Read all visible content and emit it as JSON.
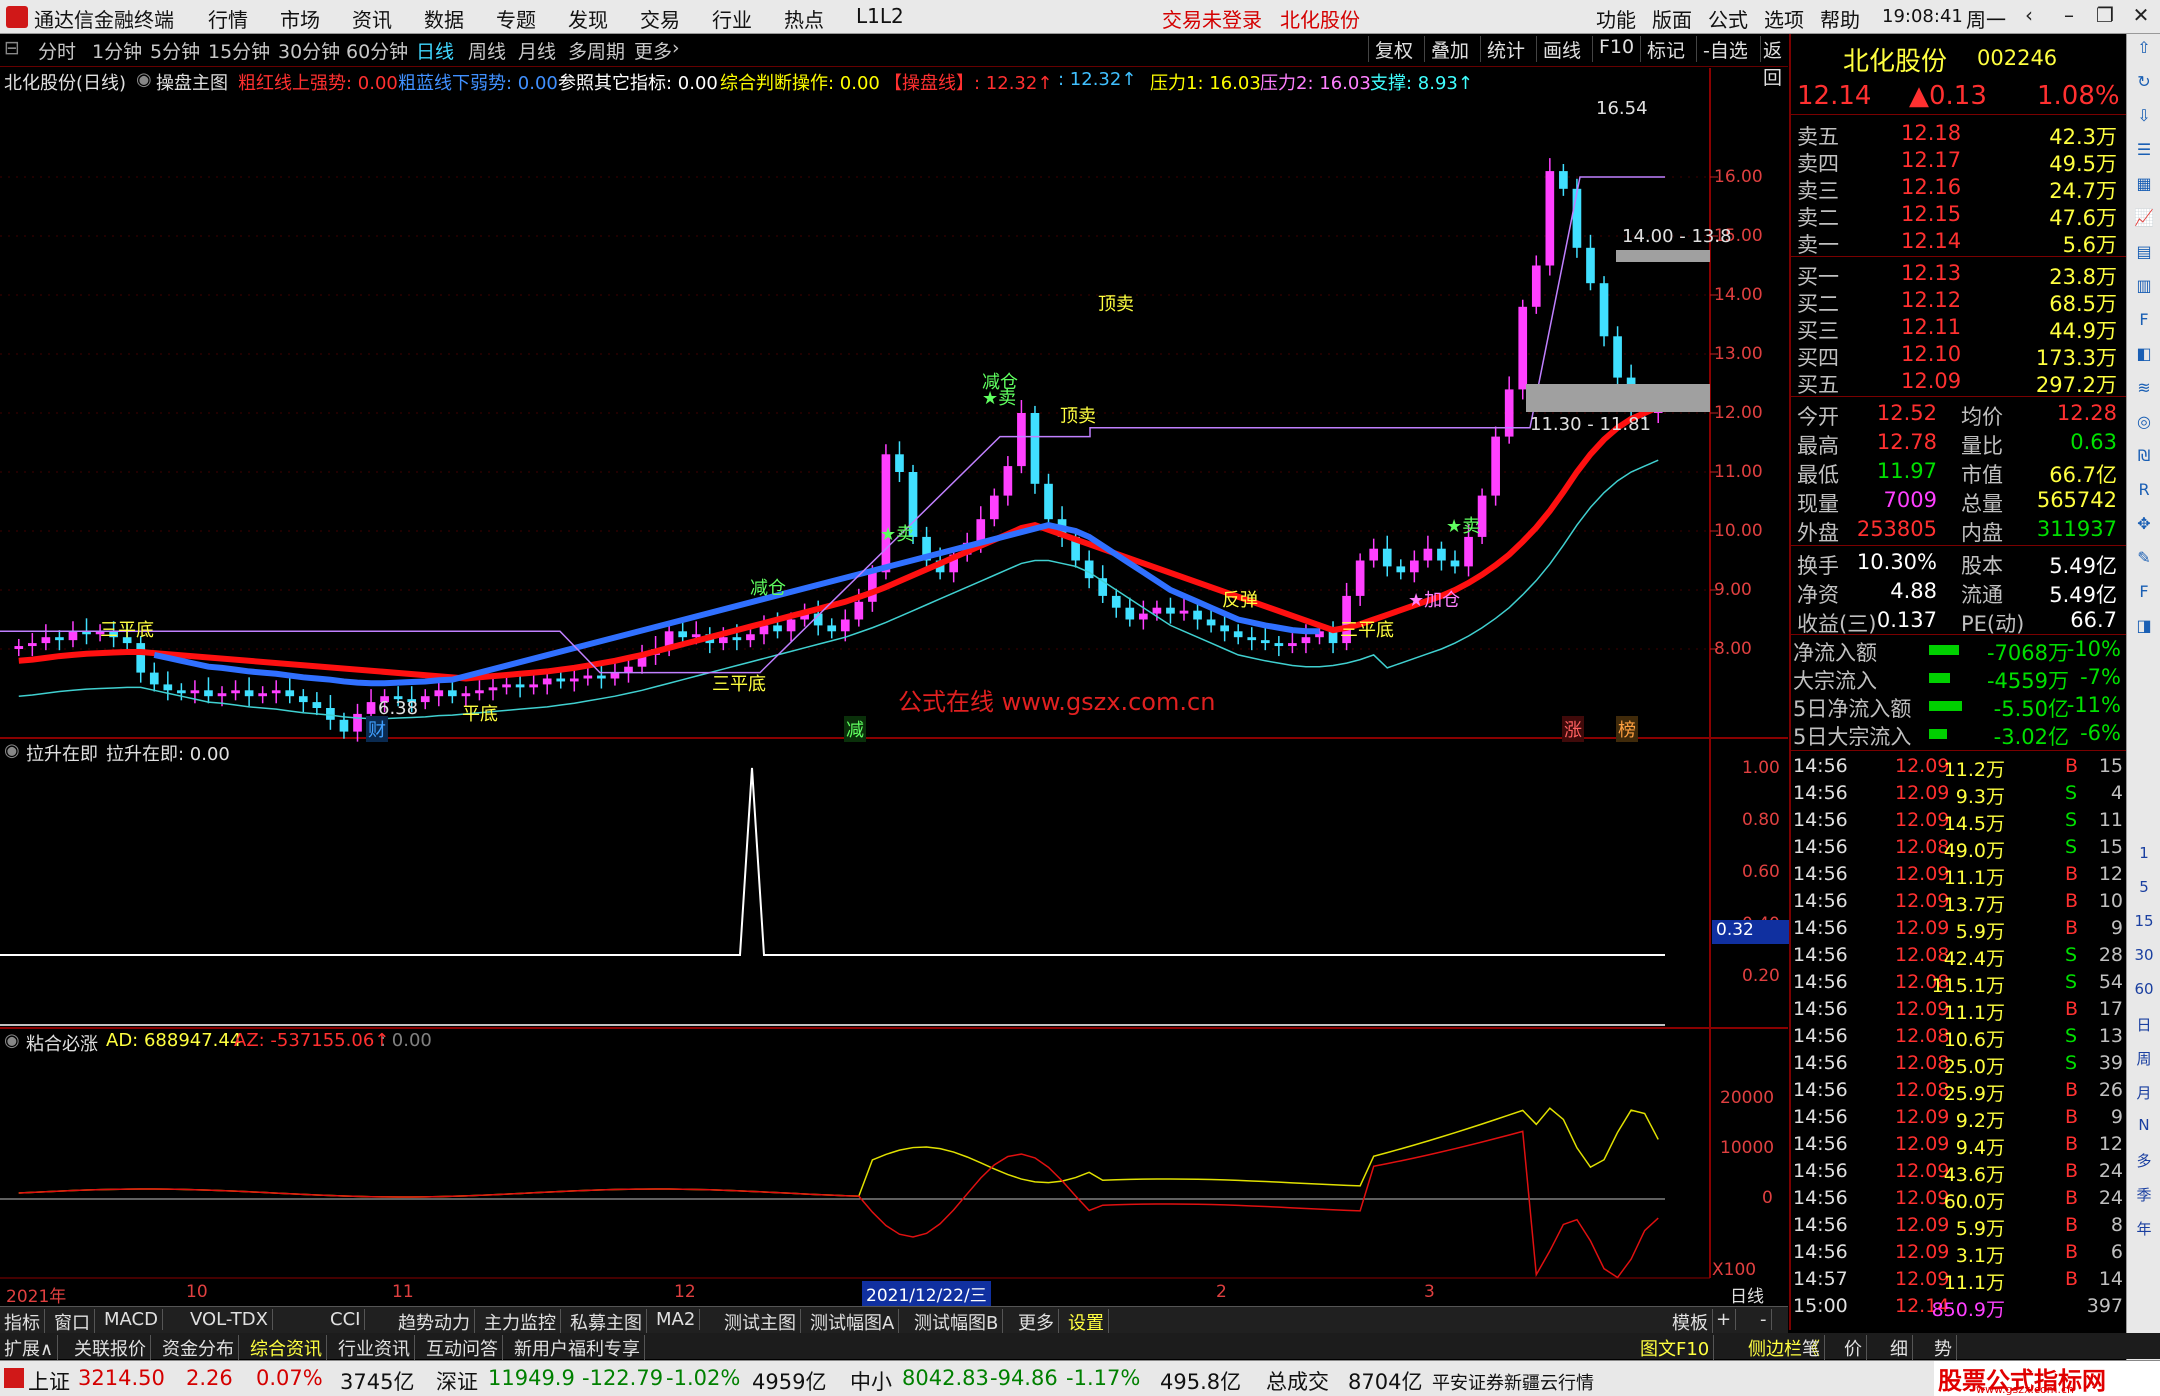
{
  "window": {
    "app_name": "通达信金融终端",
    "menus": [
      "行情",
      "市场",
      "资讯",
      "数据",
      "专题",
      "发现",
      "交易",
      "行业",
      "热点",
      "L1L2"
    ],
    "login_status": "交易未登录",
    "stock_title": "北化股份",
    "right_menus": [
      "功能",
      "版面",
      "公式",
      "选项",
      "帮助"
    ],
    "clock": "19:08:41",
    "weekday": "周一"
  },
  "periods": [
    "分时",
    "1分钟",
    "5分钟",
    "15分钟",
    "30分钟",
    "60分钟",
    "日线",
    "周线",
    "月线",
    "多周期",
    "更多"
  ],
  "active_period": "日线",
  "period_more": "更多",
  "toolbar_buttons": [
    "复权",
    "叠加",
    "统计",
    "画线",
    "F10",
    "标记",
    "-自选",
    "返回"
  ],
  "main_indicator": {
    "stock": "北化股份(日线)",
    "name": "操盘主图",
    "items": [
      {
        "label": "粗红线上强势: 0.00",
        "color": "#ff3030"
      },
      {
        "label": "粗蓝线下弱势: 0.00",
        "color": "#4090ff"
      },
      {
        "label": "参照其它指标: 0.00",
        "color": "#ffffff"
      },
      {
        "label": "综合判断操作: 0.00",
        "color": "#ffff00"
      },
      {
        "label": "【操盘线】: 12.32↑",
        "color": "#ff3030"
      },
      {
        "label": ": 12.32↑",
        "color": "#40c0ff"
      },
      {
        "label": "压力1: 16.03",
        "color": "#ffff00"
      },
      {
        "label": "压力2: 16.03",
        "color": "#ff80ff"
      },
      {
        "label": "支撑: 8.93↑",
        "color": "#40ffff"
      }
    ]
  },
  "price_axis": [
    "16.00",
    "15.00",
    "14.00",
    "13.00",
    "12.00",
    "11.00",
    "10.00",
    "9.00",
    "8.00"
  ],
  "price_annotations": {
    "high": "16.54",
    "low": "6.38",
    "band_upper": "14.00 - 13.8",
    "band_lower": "11.30 - 11.81",
    "watermark": "公式在线  www.gszx.com.cn"
  },
  "signals": [
    "三平底",
    "平底",
    "三平底",
    "三平底",
    "减仓",
    "★卖",
    "减仓",
    "★卖",
    "顶卖",
    "顶卖",
    "反弹",
    "★加仓",
    "★卖"
  ],
  "event_badges": [
    "财",
    "减",
    "涨",
    "榜"
  ],
  "sub1": {
    "title": "拉升在即",
    "value_label": "拉升在即: 0.00",
    "axis": [
      "1.00",
      "0.80",
      "0.60",
      "0.40",
      "0.20"
    ],
    "cursor_value": "0.32"
  },
  "sub2": {
    "title": "粘合必涨",
    "ad": "AD: 688947.44",
    "az": "AZ: -537155.06↑",
    "extra": ": 0.00",
    "axis": [
      "20000",
      "10000",
      "0"
    ],
    "scale": "X100"
  },
  "date_axis": [
    "2021年",
    "10",
    "11",
    "12",
    "2021/12/22/三",
    "2",
    "3"
  ],
  "period_label": "日线",
  "quote": {
    "name": "北化股份",
    "code": "002246",
    "price": "12.14",
    "change": "▲0.13",
    "pct": "1.08%",
    "asks": [
      {
        "label": "卖五",
        "price": "12.18",
        "vol": "42.3万"
      },
      {
        "label": "卖四",
        "price": "12.17",
        "vol": "49.5万"
      },
      {
        "label": "卖三",
        "price": "12.16",
        "vol": "24.7万"
      },
      {
        "label": "卖二",
        "price": "12.15",
        "vol": "47.6万"
      },
      {
        "label": "卖一",
        "price": "12.14",
        "vol": "5.6万"
      }
    ],
    "bids": [
      {
        "label": "买一",
        "price": "12.13",
        "vol": "23.8万"
      },
      {
        "label": "买二",
        "price": "12.12",
        "vol": "68.5万"
      },
      {
        "label": "买三",
        "price": "12.11",
        "vol": "44.9万"
      },
      {
        "label": "买四",
        "price": "12.10",
        "vol": "173.3万"
      },
      {
        "label": "买五",
        "price": "12.09",
        "vol": "297.2万"
      }
    ],
    "stats": [
      {
        "l1": "今开",
        "v1": "12.52",
        "c1": "#ff3030",
        "l2": "均价",
        "v2": "12.28",
        "c2": "#ff3030"
      },
      {
        "l1": "最高",
        "v1": "12.78",
        "c1": "#ff3030",
        "l2": "量比",
        "v2": "0.63",
        "c2": "#00e000"
      },
      {
        "l1": "最低",
        "v1": "11.97",
        "c1": "#00e000",
        "l2": "市值",
        "v2": "66.7亿",
        "c2": "#ffff40"
      },
      {
        "l1": "现量",
        "v1": "7009",
        "c1": "#ff40ff",
        "l2": "总量",
        "v2": "565742",
        "c2": "#ffff40"
      },
      {
        "l1": "外盘",
        "v1": "253805",
        "c1": "#ff3030",
        "l2": "内盘",
        "v2": "311937",
        "c2": "#00e000"
      },
      {
        "l1": "换手",
        "v1": "10.30%",
        "c1": "#ffffff",
        "l2": "股本",
        "v2": "5.49亿",
        "c2": "#ffffff"
      },
      {
        "l1": "净资",
        "v1": "4.88",
        "c1": "#ffffff",
        "l2": "流通",
        "v2": "5.49亿",
        "c2": "#ffffff"
      },
      {
        "l1": "收益(三)",
        "v1": "0.137",
        "c1": "#ffffff",
        "l2": "PE(动)",
        "v2": "66.7",
        "c2": "#ffffff"
      }
    ],
    "flows": [
      {
        "label": "净流入额",
        "value": "-7068万",
        "pct": "-10%",
        "bar": 10
      },
      {
        "label": "大宗流入",
        "value": "-4559万",
        "pct": "-7%",
        "bar": 7
      },
      {
        "label": "5日净流入额",
        "value": "-5.50亿",
        "pct": "-11%",
        "bar": 11
      },
      {
        "label": "5日大宗流入",
        "value": "-3.02亿",
        "pct": "-6%",
        "bar": 6
      }
    ],
    "ticks": [
      {
        "t": "14:56",
        "p": "12.09",
        "v": "11.2万",
        "d": "B",
        "n": "15"
      },
      {
        "t": "14:56",
        "p": "12.09",
        "v": "9.3万",
        "d": "S",
        "n": "4"
      },
      {
        "t": "14:56",
        "p": "12.09",
        "v": "14.5万",
        "d": "S",
        "n": "11"
      },
      {
        "t": "14:56",
        "p": "12.08",
        "v": "49.0万",
        "d": "S",
        "n": "15"
      },
      {
        "t": "14:56",
        "p": "12.09",
        "v": "11.1万",
        "d": "B",
        "n": "12"
      },
      {
        "t": "14:56",
        "p": "12.09",
        "v": "13.7万",
        "d": "B",
        "n": "10"
      },
      {
        "t": "14:56",
        "p": "12.09",
        "v": "5.9万",
        "d": "B",
        "n": "9"
      },
      {
        "t": "14:56",
        "p": "12.08",
        "v": "42.4万",
        "d": "S",
        "n": "28"
      },
      {
        "t": "14:56",
        "p": "12.08",
        "v": "115.1万",
        "d": "S",
        "n": "54"
      },
      {
        "t": "14:56",
        "p": "12.09",
        "v": "11.1万",
        "d": "B",
        "n": "17"
      },
      {
        "t": "14:56",
        "p": "12.08",
        "v": "10.6万",
        "d": "S",
        "n": "13"
      },
      {
        "t": "14:56",
        "p": "12.08",
        "v": "25.0万",
        "d": "S",
        "n": "39"
      },
      {
        "t": "14:56",
        "p": "12.08",
        "v": "25.9万",
        "d": "B",
        "n": "26"
      },
      {
        "t": "14:56",
        "p": "12.09",
        "v": "9.2万",
        "d": "B",
        "n": "9"
      },
      {
        "t": "14:56",
        "p": "12.09",
        "v": "9.4万",
        "d": "B",
        "n": "12"
      },
      {
        "t": "14:56",
        "p": "12.09",
        "v": "43.6万",
        "d": "B",
        "n": "24"
      },
      {
        "t": "14:56",
        "p": "12.09",
        "v": "60.0万",
        "d": "B",
        "n": "24"
      },
      {
        "t": "14:56",
        "p": "12.09",
        "v": "5.9万",
        "d": "B",
        "n": "8"
      },
      {
        "t": "14:56",
        "p": "12.09",
        "v": "3.1万",
        "d": "B",
        "n": "6"
      },
      {
        "t": "14:57",
        "p": "12.09",
        "v": "11.1万",
        "d": "B",
        "n": "14"
      },
      {
        "t": "15:00",
        "p": "12.14",
        "v": "850.9万",
        "d": "",
        "n": "397"
      }
    ]
  },
  "tabs": [
    "指标",
    "窗口",
    "MACD",
    "VOL-TDX",
    "CCI",
    "趋势动力",
    "主力监控",
    "私募主图",
    "MA2",
    "测试主图",
    "测试幅图A",
    "测试幅图B",
    "更多",
    "设置"
  ],
  "tabs_right": [
    "模板",
    "+",
    "-"
  ],
  "tabs2": [
    "扩展∧",
    "关联报价",
    "资金分布",
    "综合资讯",
    "行业资讯",
    "互动问答",
    "新用户福利专享"
  ],
  "tabs2_right": [
    "图文F10",
    "侧边栏《",
    "笔",
    "价",
    "细",
    "势"
  ],
  "status": {
    "sh_label": "上证",
    "sh": "3214.50",
    "sh_chg": "2.26",
    "sh_pct": "0.07%",
    "sh_amt": "3745亿",
    "sz_label": "深证",
    "sz": "11949.9",
    "sz_chg": "-122.79",
    "sz_pct": "-1.02%",
    "sz_amt": "4959亿",
    "zx_label": "中小",
    "zx": "8042.83",
    "zx_chg": "-94.86",
    "zx_pct": "-1.17%",
    "zx_amt": "495.8亿",
    "total_label": "总成交",
    "total": "8704亿",
    "broker": "平安证券新疆云行情",
    "brand": "股票公式指标网",
    "brand_url": "www.gszx.com.cn"
  },
  "sidebar_icons": [
    "up-icon",
    "refresh-icon",
    "down-icon",
    "list-icon",
    "table-icon",
    "chart-icon",
    "grid-icon",
    "bars-icon",
    "fin-icon",
    "fund-icon",
    "flow-icon",
    "circle-icon",
    "deal-icon",
    "rsi-icon",
    "move-icon",
    "pen-icon",
    "fs-icon",
    "compare-icon"
  ],
  "sidebar_text": [
    "1",
    "5",
    "15",
    "30",
    "60",
    "日",
    "周",
    "月",
    "N",
    "多",
    "季",
    "年"
  ],
  "chart_data": {
    "type": "candlestick",
    "ylim": [
      7.0,
      17.0
    ],
    "closes": [
      8.05,
      8.1,
      8.2,
      8.15,
      8.3,
      8.25,
      8.3,
      8.2,
      8.1,
      7.6,
      7.4,
      7.3,
      7.25,
      7.3,
      7.2,
      7.25,
      7.3,
      7.2,
      7.25,
      7.3,
      7.2,
      7.1,
      7.0,
      6.8,
      6.6,
      6.9,
      7.1,
      7.2,
      7.15,
      7.1,
      7.2,
      7.3,
      7.2,
      7.25,
      7.3,
      7.35,
      7.4,
      7.35,
      7.4,
      7.5,
      7.45,
      7.5,
      7.55,
      7.5,
      7.6,
      7.7,
      7.9,
      8.0,
      8.3,
      8.2,
      8.25,
      8.1,
      8.2,
      8.15,
      8.25,
      8.4,
      8.3,
      8.5,
      8.6,
      8.4,
      8.3,
      8.5,
      8.8,
      9.3,
      11.3,
      11.0,
      9.9,
      9.5,
      9.3,
      9.6,
      9.8,
      10.2,
      10.6,
      11.1,
      12.0,
      10.8,
      10.2,
      9.9,
      9.5,
      9.2,
      8.9,
      8.7,
      8.5,
      8.6,
      8.7,
      8.6,
      8.65,
      8.5,
      8.4,
      8.3,
      8.2,
      8.15,
      8.1,
      8.05,
      8.1,
      8.2,
      8.3,
      8.1,
      8.9,
      9.5,
      9.7,
      9.4,
      9.3,
      9.5,
      9.7,
      9.5,
      9.4,
      9.9,
      10.6,
      11.6,
      12.4,
      13.8,
      14.5,
      16.1,
      15.8,
      14.8,
      14.2,
      13.3,
      12.6,
      12.1,
      12.0,
      12.14
    ],
    "ma_red": [
      7.8,
      7.82,
      7.85,
      7.88,
      7.9,
      7.92,
      7.93,
      7.94,
      7.95,
      7.95,
      7.9,
      7.85,
      7.8,
      7.75,
      7.7,
      7.68,
      7.65,
      7.62,
      7.6,
      7.58,
      7.55,
      7.52,
      7.5,
      7.48,
      7.45,
      7.43,
      7.42,
      7.42,
      7.43,
      7.44,
      7.45,
      7.47,
      7.48,
      7.5,
      7.52,
      7.54,
      7.56,
      7.58,
      7.6,
      7.62,
      7.65,
      7.68,
      7.72,
      7.76,
      7.8,
      7.85,
      7.9,
      7.96,
      8.02,
      8.08,
      8.14,
      8.2,
      8.26,
      8.32,
      8.38,
      8.44,
      8.5,
      8.56,
      8.62,
      8.68,
      8.74,
      8.8,
      8.88,
      8.96,
      9.05,
      9.15,
      9.25,
      9.35,
      9.45,
      9.55,
      9.65,
      9.75,
      9.85,
      9.95,
      10.05,
      10.1,
      10.1,
      10.05,
      10.0,
      9.9,
      9.75,
      9.6,
      9.45,
      9.3,
      9.15,
      9.0,
      8.9,
      8.8,
      8.7,
      8.6,
      8.5,
      8.45,
      8.4,
      8.36,
      8.32,
      8.3,
      8.3,
      8.32,
      8.36,
      8.42,
      8.5,
      8.58,
      8.66,
      8.74,
      8.82,
      8.9,
      9.0,
      9.12,
      9.26,
      9.42,
      9.6,
      9.82,
      10.06,
      10.34,
      10.66,
      11.0,
      11.3,
      11.55,
      11.75,
      11.9,
      12.0,
      12.1
    ],
    "sub1_values": "spike to 1.00 at one bar, otherwise 0",
    "sub2_series": [
      "AD",
      "AZ"
    ]
  }
}
